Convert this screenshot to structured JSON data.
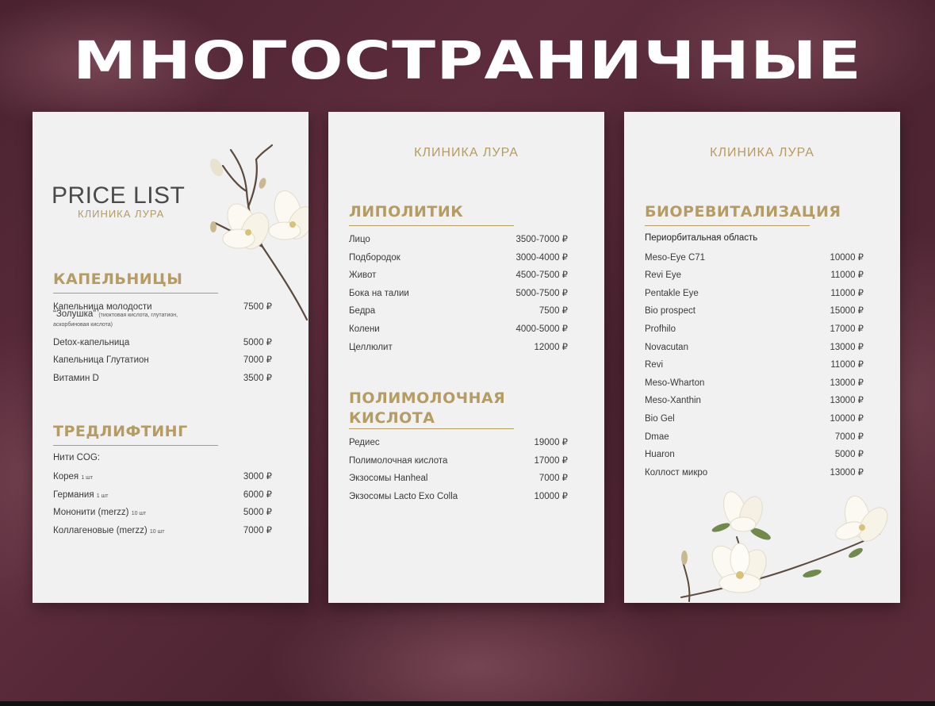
{
  "headline": "МНОГОСТРАНИЧНЫЕ",
  "page1": {
    "title": "PRICE LIST",
    "subtitle": "КЛИНИКА ЛУРА",
    "section1": {
      "title": "КАПЕЛЬНИЦЫ",
      "item1": {
        "line1": "Капельница молодости",
        "line2": "“Золушка”",
        "note": "(тиоктовая кислота, глутатион, аскорбиновая кислота)",
        "price": "7500 ₽"
      },
      "items": [
        {
          "name": "Detox-капельница",
          "price": "5000 ₽"
        },
        {
          "name": "Капельница Глутатион",
          "price": "7000 ₽"
        },
        {
          "name": "Витамин D",
          "price": "3500 ₽"
        }
      ]
    },
    "section2": {
      "title": "ТРЕДЛИФТИНГ",
      "intro": "Нити COG:",
      "items": [
        {
          "name": "Корея",
          "note": "1 шт",
          "price": "3000 ₽"
        },
        {
          "name": "Германия",
          "note": "1 шт",
          "price": "6000 ₽"
        },
        {
          "name": "Мононити (merzz)",
          "note": "10 шт",
          "price": "5000 ₽"
        },
        {
          "name": "Коллагеновые (merzz)",
          "note": "10 шт",
          "price": "7000 ₽"
        }
      ]
    }
  },
  "page2": {
    "brand": "КЛИНИКА ЛУРА",
    "section1": {
      "title": "ЛИПОЛИТИК",
      "items": [
        {
          "name": "Лицо",
          "price": "3500-7000 ₽"
        },
        {
          "name": "Подбородок",
          "price": "3000-4000 ₽"
        },
        {
          "name": "Живот",
          "price": "4500-7500 ₽"
        },
        {
          "name": "Бока на талии",
          "price": "5000-7500 ₽"
        },
        {
          "name": "Бедра",
          "price": "7500 ₽"
        },
        {
          "name": "Колени",
          "price": "4000-5000 ₽"
        },
        {
          "name": "Целлюлит",
          "price": "12000 ₽"
        }
      ]
    },
    "section2": {
      "title_line1": "ПОЛИМОЛОЧНАЯ",
      "title_line2": "КИСЛОТА",
      "items": [
        {
          "name": "Редиес",
          "price": "19000 ₽"
        },
        {
          "name": "Полимолочная кислота",
          "price": "17000 ₽"
        },
        {
          "name": "Экзосомы Hanheal",
          "price": "7000 ₽"
        },
        {
          "name": "Экзосомы Lacto Exo Colla",
          "price": "10000 ₽"
        }
      ]
    }
  },
  "page3": {
    "brand": "КЛИНИКА ЛУРА",
    "section1": {
      "title": "БИОРЕВИТАЛИЗАЦИЯ",
      "subheading": "Периорбитальная область",
      "items": [
        {
          "name": "Meso-Eye C71",
          "price": "10000 ₽"
        },
        {
          "name": "Revi Eye",
          "price": "11000 ₽"
        },
        {
          "name": "Pentakle Eye",
          "price": "11000 ₽"
        },
        {
          "name": "Bio prospect",
          "price": "15000 ₽"
        },
        {
          "name": "Profhilo",
          "price": "17000 ₽"
        },
        {
          "name": "Novacutan",
          "price": "13000 ₽"
        },
        {
          "name": "Revi",
          "price": "11000 ₽"
        },
        {
          "name": "Meso-Wharton",
          "price": "13000 ₽"
        },
        {
          "name": "Meso-Xanthin",
          "price": "13000 ₽"
        },
        {
          "name": "Bio Gel",
          "price": "10000 ₽"
        },
        {
          "name": "Dmae",
          "price": "7000 ₽"
        },
        {
          "name": "Huaron",
          "price": "5000 ₽"
        },
        {
          "name": "Коллост микро",
          "price": "13000 ₽"
        }
      ]
    }
  },
  "colors": {
    "background": "#5a2c3a",
    "gold": "#b49c62",
    "page": "#f1f1f1",
    "text": "#3a3a3a"
  },
  "icons": [
    "magnolia-branch-illustration",
    "magnolia-flowers-illustration"
  ]
}
